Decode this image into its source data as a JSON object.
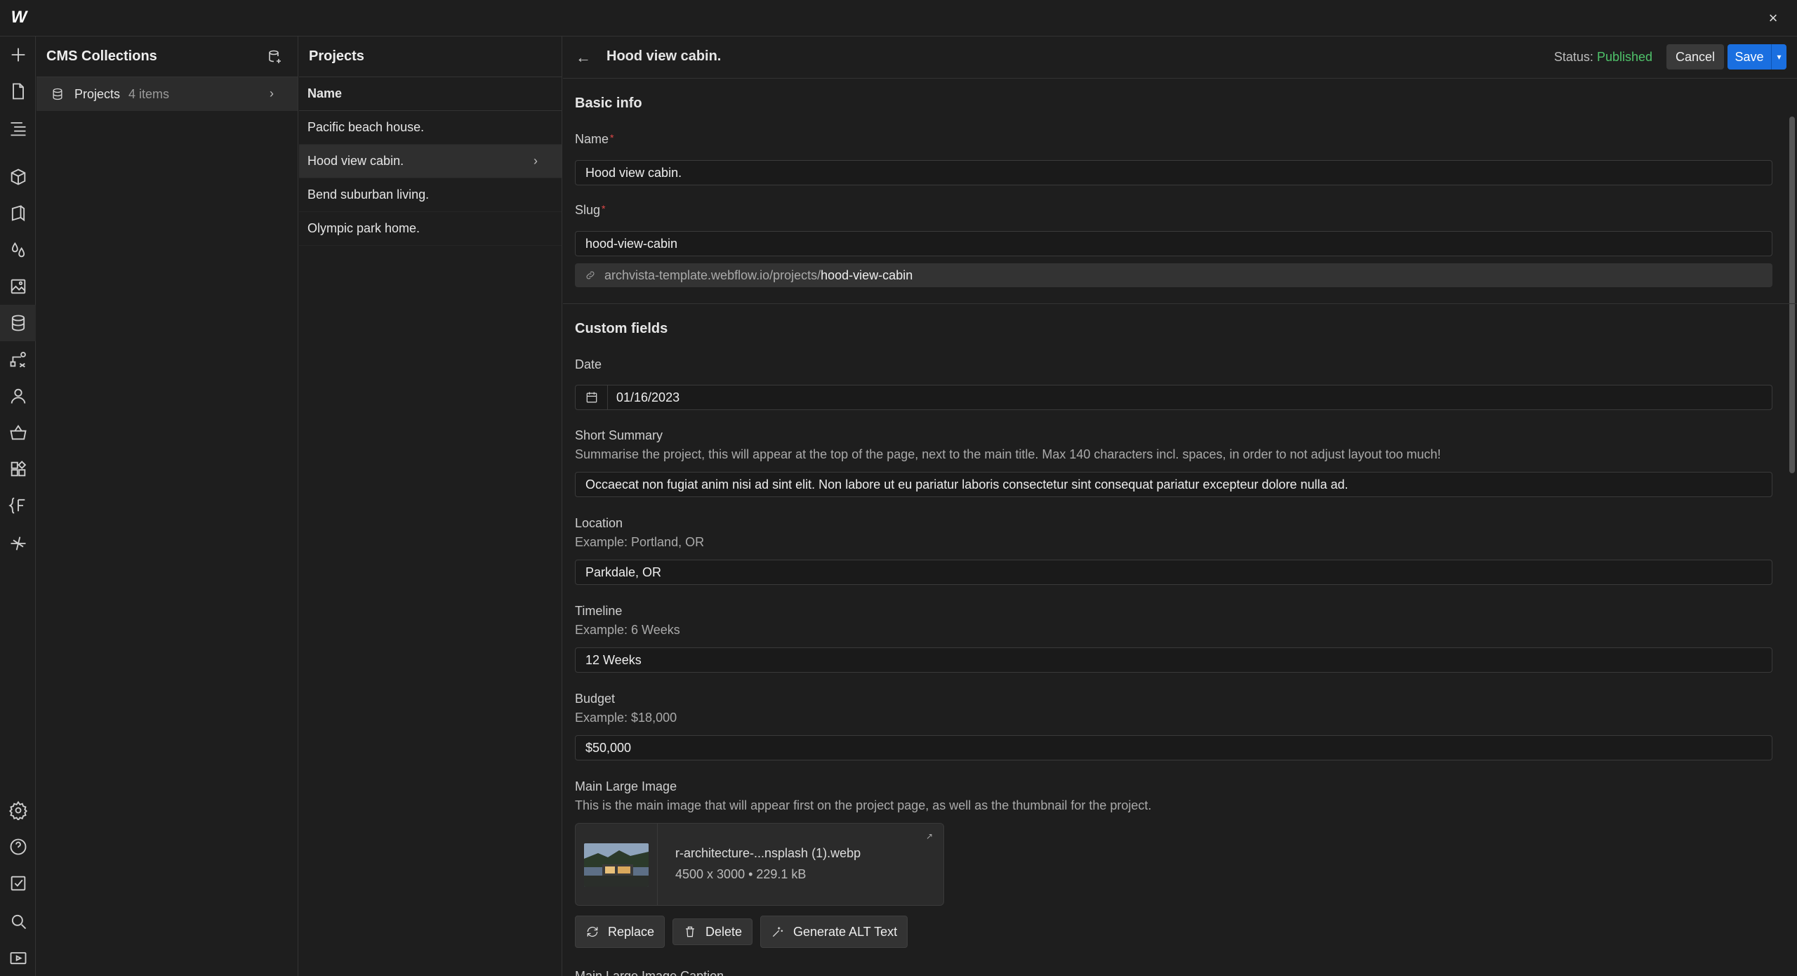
{
  "app": {
    "logo": "W",
    "close": "×"
  },
  "sidebar_nav": {
    "items": [
      {
        "icon": "plus-icon",
        "name": "add"
      },
      {
        "icon": "page-icon",
        "name": "pages"
      },
      {
        "icon": "navigator-icon",
        "name": "navigator"
      },
      {
        "icon": "cube-icon",
        "name": "components"
      },
      {
        "icon": "style-book-icon",
        "name": "style-guide"
      },
      {
        "icon": "variables-drops-icon",
        "name": "variables"
      },
      {
        "icon": "assets-image-icon",
        "name": "assets"
      },
      {
        "icon": "cms-database-icon",
        "name": "cms"
      },
      {
        "icon": "logic-flow-icon",
        "name": "logic"
      },
      {
        "icon": "users-icon",
        "name": "users"
      },
      {
        "icon": "ecommerce-basket-icon",
        "name": "ecommerce"
      },
      {
        "icon": "apps-icon",
        "name": "apps"
      },
      {
        "icon": "fonts-icon",
        "name": "fonts"
      },
      {
        "icon": "plugin-icon",
        "name": "plugin"
      },
      {
        "icon": "settings-gear-icon",
        "name": "settings"
      },
      {
        "icon": "help-icon",
        "name": "help"
      },
      {
        "icon": "audit-check-icon",
        "name": "audit"
      },
      {
        "icon": "search-icon",
        "name": "search"
      },
      {
        "icon": "video-tutorial-icon",
        "name": "tutorials"
      }
    ]
  },
  "collections": {
    "title": "CMS Collections",
    "items": [
      {
        "name": "Projects",
        "count": "4 items"
      }
    ]
  },
  "projects": {
    "title": "Projects",
    "column": "Name",
    "items": [
      {
        "name": "Pacific beach house."
      },
      {
        "name": "Hood view cabin."
      },
      {
        "name": "Bend suburban living."
      },
      {
        "name": "Olympic park home."
      }
    ]
  },
  "editor": {
    "title": "Hood view cabin.",
    "status_label": "Status: ",
    "status_value": "Published",
    "cancel": "Cancel",
    "save": "Save",
    "basic_info": "Basic info",
    "name_label": "Name",
    "name_value": "Hood view cabin.",
    "slug_label": "Slug",
    "slug_value": "hood-view-cabin",
    "slug_url_prefix": "archvista-template.webflow.io/projects/",
    "slug_url_slug": "hood-view-cabin",
    "custom_fields": "Custom fields",
    "date_label": "Date",
    "date_value": "01/16/2023",
    "summary_label": "Short Summary",
    "summary_help": "Summarise the project, this will appear at the top of the page, next to the main title. Max 140 characters incl. spaces, in order to not adjust layout too much!",
    "summary_value": "Occaecat non fugiat anim nisi ad sint elit. Non labore ut eu pariatur laboris consectetur sint consequat pariatur excepteur dolore nulla ad.",
    "location_label": "Location",
    "location_help": "Example: Portland, OR",
    "location_value": "Parkdale, OR",
    "timeline_label": "Timeline",
    "timeline_help": "Example: 6 Weeks",
    "timeline_value": "12 Weeks",
    "budget_label": "Budget",
    "budget_help": "Example: $18,000",
    "budget_value": "$50,000",
    "image_label": "Main Large Image",
    "image_help": "This is the main image that will appear first on the project page, as well as the thumbnail for the project.",
    "image_file": "r-architecture-...nsplash (1).webp",
    "image_meta": "4500 x 3000 • 229.1 kB",
    "replace": "Replace",
    "delete": "Delete",
    "generate_alt": "Generate ALT Text",
    "caption_label": "Main Large Image Caption"
  },
  "colors": {
    "accent": "#1a6fe0",
    "published": "#4fc26a",
    "required": "#e04848"
  }
}
